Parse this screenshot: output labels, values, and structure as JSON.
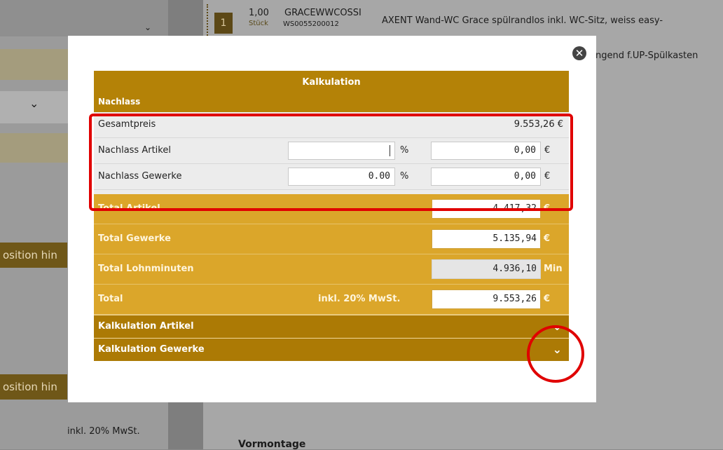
{
  "background": {
    "item_badge": "1",
    "item_qty": "1,00",
    "item_unit": "Stück",
    "item_code": "GRACEWWCOSSI",
    "item_subcode": "WS0055200012",
    "item_desc": "AXENT Wand-WC Grace spülrandlos inkl. WC-Sitz, weiss easy-",
    "item2_desc": "ngend f.UP-Spülkasten",
    "position_btn_1": "osition hin",
    "position_btn_2": "osition hin",
    "vat_label": "inkl. 20% MwSt.",
    "section_label": "Vormontage"
  },
  "modal": {
    "close_icon": "close-icon",
    "title": "Kalkulation",
    "subtitle": "Nachlass",
    "gesamtpreis": {
      "label": "Gesamtpreis",
      "value": "9.553,26 €"
    },
    "nachlass_artikel": {
      "label": "Nachlass Artikel",
      "percent_value": "",
      "percent_unit": "%",
      "amount_value": "0,00",
      "amount_unit": "€"
    },
    "nachlass_gewerke": {
      "label": "Nachlass Gewerke",
      "percent_value": "0.00",
      "percent_unit": "%",
      "amount_value": "0,00",
      "amount_unit": "€"
    },
    "totals": [
      {
        "label": "Total Artikel",
        "note": "",
        "value": "4.417,32",
        "unit": "€",
        "readonly": false
      },
      {
        "label": "Total Gewerke",
        "note": "",
        "value": "5.135,94",
        "unit": "€",
        "readonly": false
      },
      {
        "label": "Total Lohnminuten",
        "note": "",
        "value": "4.936,10",
        "unit": "Min",
        "readonly": true
      },
      {
        "label": "Total",
        "note": "inkl. 20% MwSt.",
        "value": "9.553,26",
        "unit": "€",
        "readonly": false
      }
    ],
    "sections": [
      {
        "label": "Kalkulation Artikel",
        "icon": "chevron-down-icon"
      },
      {
        "label": "Kalkulation Gewerke",
        "icon": "chevron-down-icon"
      }
    ]
  },
  "colors": {
    "header_gold": "#b48207",
    "row_gold": "#dba62a",
    "section_brown": "#ac7a05",
    "highlight_red": "#e00000"
  }
}
